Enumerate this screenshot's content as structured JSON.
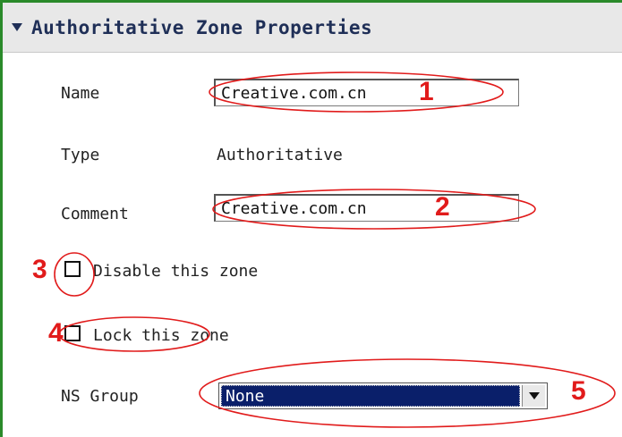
{
  "panel": {
    "title": "Authoritative Zone Properties"
  },
  "form": {
    "name_label": "Name",
    "name_value": "Creative.com.cn",
    "type_label": "Type",
    "type_value": "Authoritative",
    "comment_label": "Comment",
    "comment_value": "Creative.com.cn",
    "disable_label": "Disable this zone",
    "lock_label": "Lock this zone",
    "ns_group_label": "NS Group",
    "ns_group_value": "None"
  },
  "annotations": {
    "n1": "1",
    "n2": "2",
    "n3": "3",
    "n4": "4",
    "n5": "5",
    "color": "#e11b1b"
  },
  "icons": {
    "collapse": "triangle-down-icon",
    "select_arrow": "chevron-down-icon"
  }
}
